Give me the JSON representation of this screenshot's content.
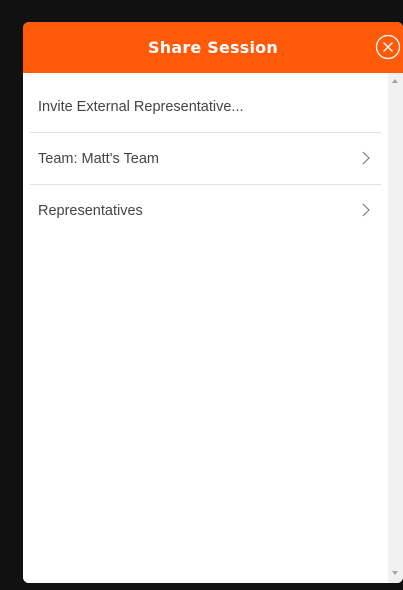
{
  "dialog": {
    "title": "Share Session",
    "close_icon": "close-circle-icon",
    "header_color": "#ff5a09"
  },
  "menu": {
    "items": [
      {
        "label": "Invite External Representative...",
        "has_chevron": false
      },
      {
        "label": "Team: Matt's Team",
        "has_chevron": true,
        "icon": "chevron-right-icon"
      },
      {
        "label": "Representatives",
        "has_chevron": true,
        "icon": "chevron-right-icon"
      }
    ]
  },
  "scrollbar": {
    "up_icon": "scroll-up-arrow-icon",
    "down_icon": "scroll-down-arrow-icon"
  }
}
